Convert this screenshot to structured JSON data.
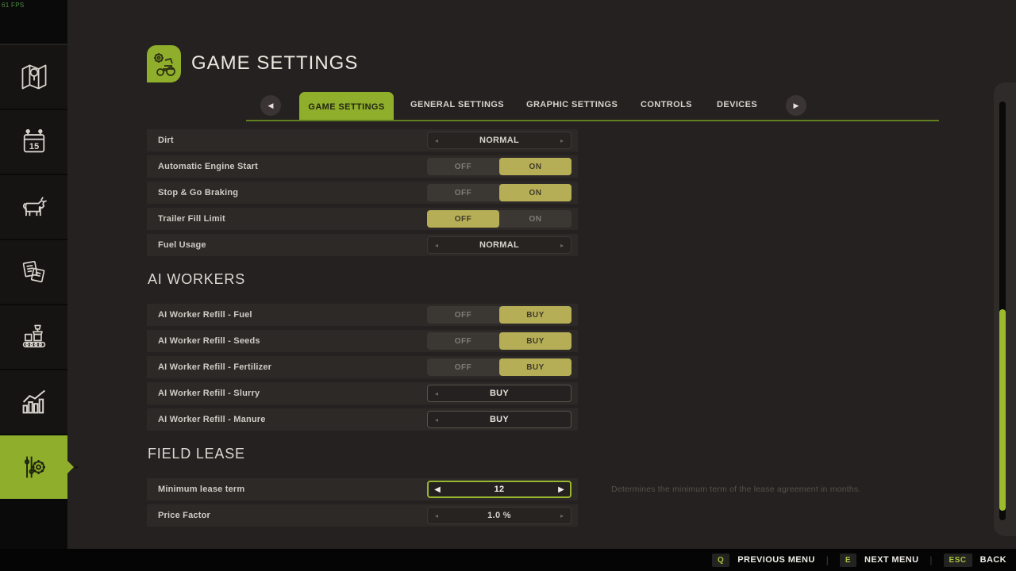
{
  "fps": "61 FPS",
  "header": {
    "title": "GAME SETTINGS"
  },
  "icons": {
    "arrow_left": "◂",
    "arrow_right": "▸",
    "arrow_left_solid": "◀",
    "arrow_right_solid": "▶",
    "sidebar": [
      "map-icon",
      "calendar-icon",
      "animals-icon",
      "finances-icon",
      "production-icon",
      "statistics-icon",
      "settings-icon"
    ]
  },
  "tabs": {
    "items": [
      "GAME SETTINGS",
      "GENERAL SETTINGS",
      "GRAPHIC SETTINGS",
      "CONTROLS",
      "DEVICES"
    ],
    "active": "GAME SETTINGS"
  },
  "groups": {
    "general": {
      "rows": [
        {
          "label": "Dirt",
          "type": "selector",
          "value": "NORMAL"
        },
        {
          "label": "Automatic Engine Start",
          "type": "toggle",
          "off": "OFF",
          "on": "ON",
          "active": "ON"
        },
        {
          "label": "Stop & Go Braking",
          "type": "toggle",
          "off": "OFF",
          "on": "ON",
          "active": "ON"
        },
        {
          "label": "Trailer Fill Limit",
          "type": "toggle",
          "off": "OFF",
          "on": "ON",
          "active": "OFF"
        },
        {
          "label": "Fuel Usage",
          "type": "selector",
          "value": "NORMAL"
        }
      ]
    },
    "ai_workers": {
      "title": "AI WORKERS",
      "rows": [
        {
          "label": "AI Worker Refill - Fuel",
          "type": "toggle",
          "off": "OFF",
          "on": "BUY",
          "active": "BUY"
        },
        {
          "label": "AI Worker Refill - Seeds",
          "type": "toggle",
          "off": "OFF",
          "on": "BUY",
          "active": "BUY"
        },
        {
          "label": "AI Worker Refill - Fertilizer",
          "type": "toggle",
          "off": "OFF",
          "on": "BUY",
          "active": "BUY"
        },
        {
          "label": "AI Worker Refill - Slurry",
          "type": "selector",
          "value": "BUY"
        },
        {
          "label": "AI Worker Refill - Manure",
          "type": "selector",
          "value": "BUY"
        }
      ]
    },
    "field_lease": {
      "title": "FIELD LEASE",
      "rows": [
        {
          "label": "Minimum lease term",
          "type": "selector",
          "value": "12",
          "focused": true
        },
        {
          "label": "Price Factor",
          "type": "selector",
          "value": "1.0 %"
        }
      ],
      "help": "Determines the minimum term of the lease agreement in months."
    }
  },
  "footer": {
    "items": [
      {
        "key": "Q",
        "label": "PREVIOUS MENU"
      },
      {
        "key": "E",
        "label": "NEXT MENU"
      },
      {
        "key": "ESC",
        "label": "BACK"
      }
    ]
  },
  "colors": {
    "accent_green": "#8fae2b",
    "toggle_active": "#b6ae57",
    "scroll_thumb": "#9cba2e",
    "row_bg": "#2c2927",
    "page_bg": "#242120"
  }
}
